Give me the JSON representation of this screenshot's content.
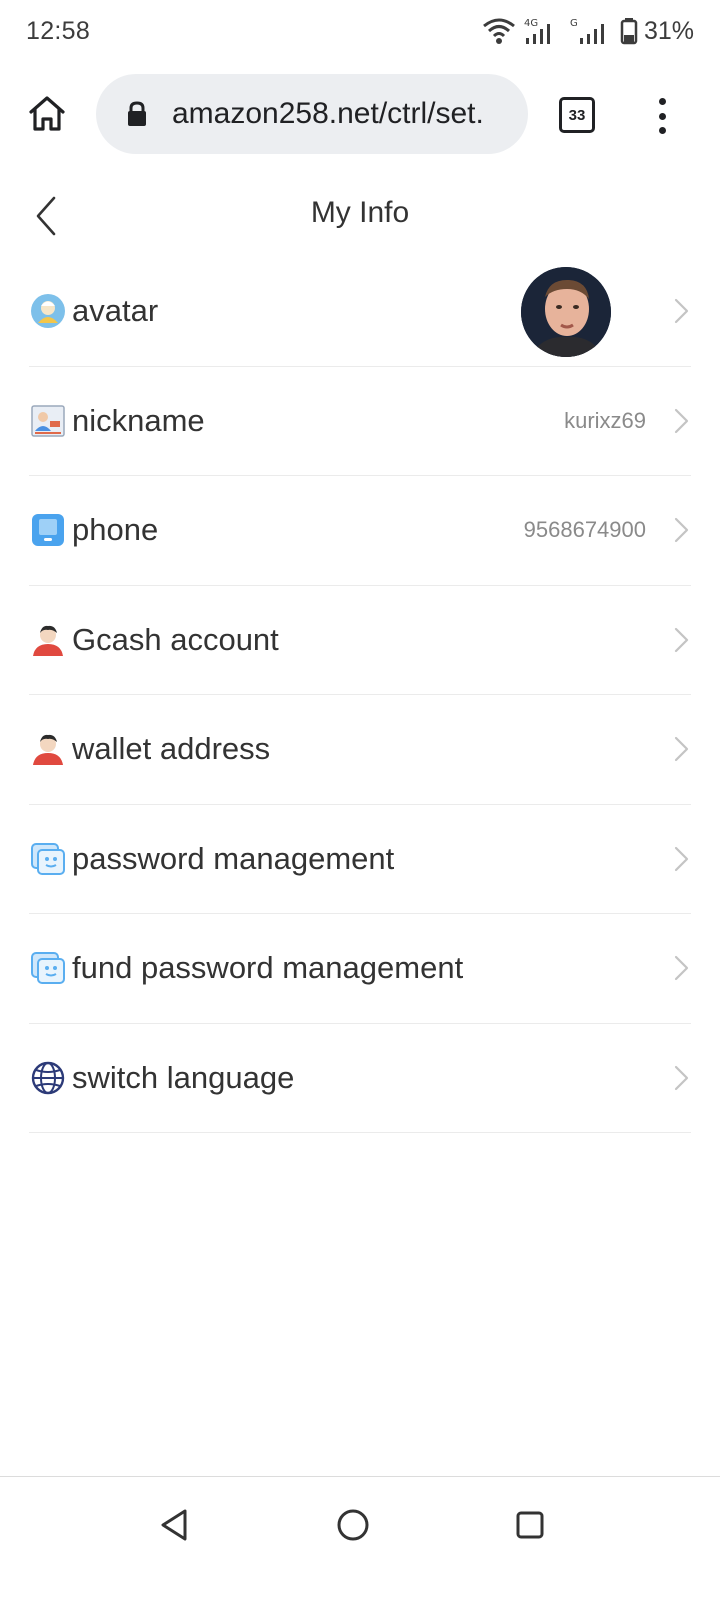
{
  "status_bar": {
    "time": "12:58",
    "network_label": "4G",
    "network_label_2": "G",
    "battery_text": "31%",
    "icons": [
      "wifi-icon",
      "signal-icon",
      "battery-icon"
    ]
  },
  "browser": {
    "url": "amazon258.net/ctrl/set.",
    "tab_count": "33",
    "icons": [
      "home-icon",
      "lock-icon",
      "tabs-icon",
      "more-vert-icon"
    ]
  },
  "header": {
    "title": "My Info",
    "back_icon": "chevron-left-icon"
  },
  "list": {
    "items": [
      {
        "label": "avatar",
        "value": "",
        "icon": "avatar-icon"
      },
      {
        "label": "nickname",
        "value": "kurixz69",
        "icon": "id-card-icon"
      },
      {
        "label": "phone",
        "value": "9568674900",
        "icon": "phone-icon"
      },
      {
        "label": "Gcash account",
        "value": "",
        "icon": "person-icon"
      },
      {
        "label": "wallet address",
        "value": "",
        "icon": "person-icon"
      },
      {
        "label": "password management",
        "value": "",
        "icon": "chat-key-icon"
      },
      {
        "label": "fund password management",
        "value": "",
        "icon": "chat-key-icon"
      },
      {
        "label": "switch language",
        "value": "",
        "icon": "globe-icon"
      }
    ],
    "chevron_icon": "chevron-right-icon"
  },
  "colors": {
    "text": "#333333",
    "muted": "#8a8a8a",
    "divider": "#ebebeb",
    "url_bg": "#eceef1"
  },
  "nav_bar": {
    "icons": [
      "back-triangle-icon",
      "home-circle-icon",
      "recents-square-icon"
    ]
  }
}
